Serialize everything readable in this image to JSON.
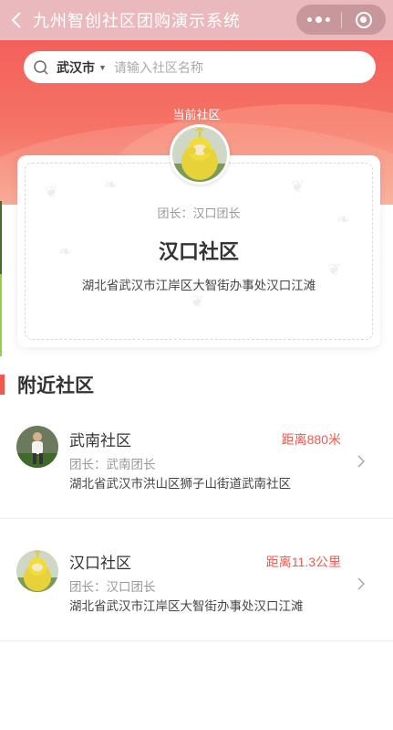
{
  "topbar": {
    "title": "九州智创社区团购演示系统"
  },
  "search": {
    "city": "武汉市",
    "placeholder": "请输入社区名称"
  },
  "current": {
    "label": "当前社区",
    "leader": "团长：汉口团长",
    "name": "汉口社区",
    "address": "湖北省武汉市江岸区大智街办事处汉口江滩"
  },
  "nearby": {
    "title": "附近社区",
    "items": [
      {
        "name": "武南社区",
        "distance": "距离880米",
        "leader": "团长：武南团长",
        "address": "湖北省武汉市洪山区狮子山街道武南社区",
        "avatar": "football-player"
      },
      {
        "name": "汉口社区",
        "distance": "距离11.3公里",
        "leader": "团长：汉口团长",
        "address": "湖北省武汉市江岸区大智街办事处汉口江滩",
        "avatar": "yellow-teletubby"
      }
    ]
  },
  "colors": {
    "accent": "#f05a4f",
    "topbar": "#e9b9bd"
  }
}
